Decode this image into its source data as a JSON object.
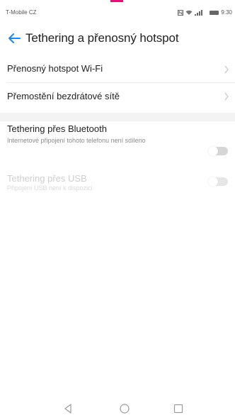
{
  "status_bar": {
    "carrier": "T-Mobile CZ",
    "time": "9:30",
    "icons": [
      "nfc-icon",
      "wifi-icon",
      "signal-icon",
      "battery-icon"
    ]
  },
  "app_bar": {
    "title": "Tethering a přenosný hotspot",
    "back_icon": "arrow-left-icon"
  },
  "settings": {
    "hotspot": {
      "title": "Přenosný hotspot Wi-Fi"
    },
    "bridge": {
      "title": "Přemostění bezdrátové sítě"
    },
    "bluetooth": {
      "title": "Tethering přes Bluetooth",
      "subtitle": "Internetové připojení tohoto telefonu není sdíleno",
      "enabled": false
    },
    "usb": {
      "title": "Tethering přes USB",
      "subtitle": "Připojení USB není k dispozici",
      "enabled": false,
      "available": false
    }
  },
  "nav_bar": {
    "buttons": [
      "back-triangle-icon",
      "home-circle-icon",
      "recents-square-icon"
    ]
  },
  "colors": {
    "accent": "#1e88e5",
    "brand_mark": "#e3127a",
    "text_primary": "#1f1f1f",
    "text_secondary": "#8a8a8a",
    "text_disabled": "#cfcfcf",
    "toggle_off": "#d6d6d6"
  }
}
